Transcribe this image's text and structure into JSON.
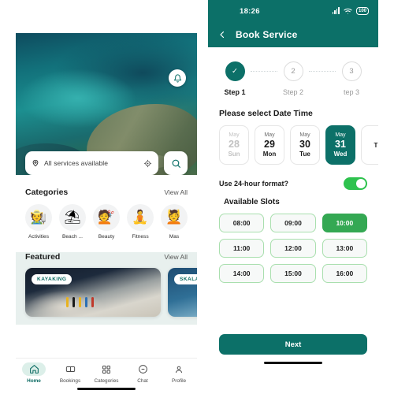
{
  "colors": {
    "brand_teal": "#0c7068",
    "accent_green": "#34a853",
    "toggle_green": "#2ec24e",
    "featured_bg": "#e8f0ee",
    "slot_border": "#a9dfae"
  },
  "left_phone": {
    "hero": {
      "notification_icon": "bell-icon",
      "carousel_dots": 5,
      "carousel_active_index": 2
    },
    "search": {
      "location_icon": "map-pin-icon",
      "value": "All services available",
      "placeholder": "All services available",
      "locate_icon": "crosshair-icon",
      "search_icon": "search-icon"
    },
    "categories_section": {
      "title": "Categories",
      "view_all": "View All",
      "items": [
        {
          "label": "Activities",
          "icon": "hiking-icon",
          "glyph": "🧑‍🌾"
        },
        {
          "label": "Beach ...",
          "icon": "beach-umbrella-icon",
          "glyph": "⛱"
        },
        {
          "label": "Beauty",
          "icon": "hair-salon-icon",
          "glyph": "💇"
        },
        {
          "label": "Fitness",
          "icon": "yoga-icon",
          "glyph": "🧘"
        },
        {
          "label": "Mas",
          "icon": "massage-icon",
          "glyph": "💆"
        }
      ]
    },
    "featured_section": {
      "title": "Featured",
      "view_all": "View All",
      "cards": [
        {
          "tag": "KAYAKING"
        },
        {
          "tag": "SKALA"
        }
      ]
    },
    "tabbar": {
      "items": [
        {
          "label": "Home",
          "icon": "home-icon",
          "active": true
        },
        {
          "label": "Bookings",
          "icon": "ticket-icon",
          "active": false
        },
        {
          "label": "Categories",
          "icon": "grid-icon",
          "active": false
        },
        {
          "label": "Chat",
          "icon": "chat-icon",
          "active": false
        },
        {
          "label": "Profile",
          "icon": "person-icon",
          "active": false
        }
      ]
    }
  },
  "right_phone": {
    "status_bar": {
      "time": "18:26",
      "signal_icon": "signal-bars-icon",
      "wifi_icon": "wifi-icon",
      "battery_icon": "battery-icon",
      "battery_level": "100"
    },
    "appbar": {
      "back_icon": "chevron-left-icon",
      "title": "Book Service"
    },
    "stepper": {
      "steps": [
        {
          "marker": "✓",
          "label": "Step 1",
          "state": "done"
        },
        {
          "marker": "2",
          "label": "Step 2",
          "state": "pending"
        },
        {
          "marker": "3",
          "label": "tep 3",
          "state": "pending"
        }
      ]
    },
    "date_section": {
      "title": "Please select Date Time",
      "dates": [
        {
          "month": "May",
          "day": "28",
          "weekday": "Sun",
          "state": "disabled"
        },
        {
          "month": "May",
          "day": "29",
          "weekday": "Mon",
          "state": "normal"
        },
        {
          "month": "May",
          "day": "30",
          "weekday": "Tue",
          "state": "normal"
        },
        {
          "month": "May",
          "day": "31",
          "weekday": "Wed",
          "state": "selected"
        },
        {
          "month": "",
          "day": "",
          "weekday": "T",
          "state": "clipped"
        }
      ]
    },
    "format_toggle": {
      "label": "Use 24-hour format?",
      "value": "on"
    },
    "slots_section": {
      "title": "Available Slots",
      "slots": [
        {
          "time": "08:00",
          "selected": false
        },
        {
          "time": "09:00",
          "selected": false
        },
        {
          "time": "10:00",
          "selected": true
        },
        {
          "time": "11:00",
          "selected": false
        },
        {
          "time": "12:00",
          "selected": false
        },
        {
          "time": "13:00",
          "selected": false
        },
        {
          "time": "14:00",
          "selected": false
        },
        {
          "time": "15:00",
          "selected": false
        },
        {
          "time": "16:00",
          "selected": false
        }
      ]
    },
    "next_button": {
      "label": "Next"
    }
  }
}
